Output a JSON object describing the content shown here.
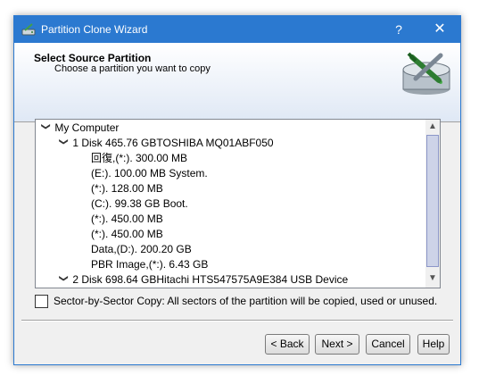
{
  "window": {
    "title": "Partition Clone Wizard",
    "help_glyph": "?",
    "close_glyph": "✕"
  },
  "header": {
    "title": "Select Source Partition",
    "subtitle": "Choose a partition you want to copy"
  },
  "tree": {
    "root": "My Computer",
    "disk1": "1 Disk 465.76 GBTOSHIBA MQ01ABF050",
    "partitions": [
      "回復,(*:).   300.00 MB",
      "(E:).   100.00 MB System.",
      "(*:).   128.00 MB",
      "(C:).   99.38 GB Boot.",
      "(*:).   450.00 MB",
      "(*:).   450.00 MB",
      "Data,(D:).   200.20 GB",
      "PBR Image,(*:).   6.43 GB"
    ],
    "disk2": "2 Disk 698.64 GBHitachi  HTS547575A9E384  USB Device"
  },
  "sector_copy": {
    "label": "Sector-by-Sector Copy: All sectors of the partition will be copied, used or unused.",
    "checked": false
  },
  "buttons": {
    "back": "< Back",
    "next": "Next >",
    "cancel": "Cancel",
    "help": "Help"
  }
}
